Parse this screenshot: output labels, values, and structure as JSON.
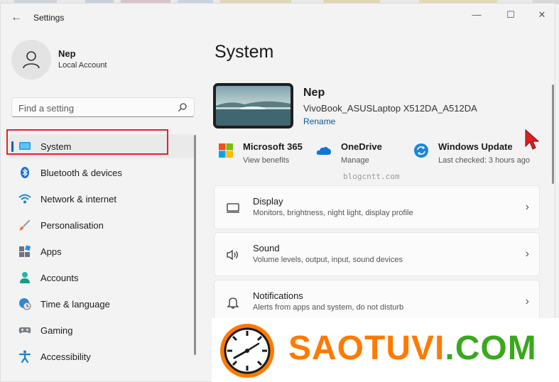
{
  "window": {
    "title": "Settings",
    "back_glyph": "←",
    "minimize_glyph": "—",
    "maximize_glyph": "☐",
    "close_glyph": "✕"
  },
  "user": {
    "name": "Nep",
    "account_type": "Local Account"
  },
  "search": {
    "placeholder": "Find a setting"
  },
  "sidebar": {
    "items": [
      {
        "label": "System",
        "icon": "monitor-icon",
        "selected": true
      },
      {
        "label": "Bluetooth & devices",
        "icon": "bluetooth-icon"
      },
      {
        "label": "Network & internet",
        "icon": "wifi-icon"
      },
      {
        "label": "Personalisation",
        "icon": "brush-icon"
      },
      {
        "label": "Apps",
        "icon": "apps-icon"
      },
      {
        "label": "Accounts",
        "icon": "person-icon"
      },
      {
        "label": "Time & language",
        "icon": "globe-clock-icon"
      },
      {
        "label": "Gaming",
        "icon": "gamepad-icon"
      },
      {
        "label": "Accessibility",
        "icon": "accessibility-icon"
      }
    ]
  },
  "main": {
    "title": "System",
    "device": {
      "name": "Nep",
      "model": "VivoBook_ASUSLaptop X512DA_A512DA",
      "rename": "Rename"
    },
    "quick": [
      {
        "title": "Microsoft 365",
        "subtitle": "View benefits",
        "icon": "microsoft-logo-icon"
      },
      {
        "title": "OneDrive",
        "subtitle": "Manage",
        "icon": "cloud-icon"
      },
      {
        "title": "Windows Update",
        "subtitle": "Last checked: 3 hours ago",
        "icon": "update-icon"
      }
    ],
    "cards": [
      {
        "title": "Display",
        "subtitle": "Monitors, brightness, night light, display profile",
        "icon": "display-icon"
      },
      {
        "title": "Sound",
        "subtitle": "Volume levels, output, input, sound devices",
        "icon": "speaker-icon"
      },
      {
        "title": "Notifications",
        "subtitle": "Alerts from apps and system, do not disturb",
        "icon": "bell-icon"
      }
    ],
    "chevron": "›"
  },
  "watermark": {
    "small": "blogcntt.com",
    "banner_main": "SAOTUVI",
    "banner_suffix": ".COM"
  },
  "colors": {
    "accent": "#005fb8",
    "highlight": "#e0232d",
    "banner_orange": "#ff7a00",
    "banner_green": "#3aa81e"
  }
}
